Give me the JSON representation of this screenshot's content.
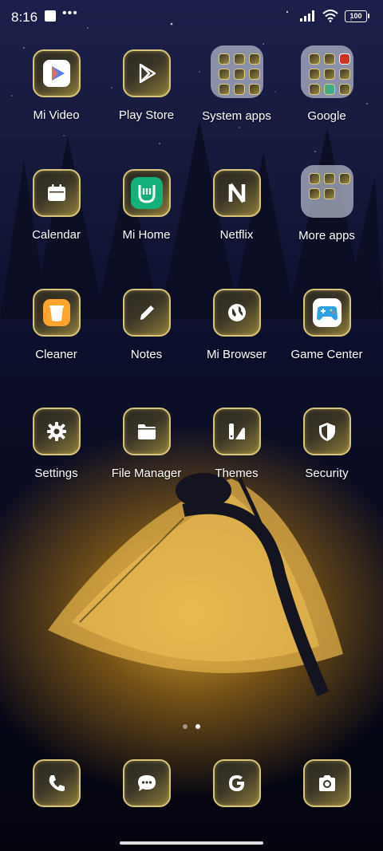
{
  "status_bar": {
    "time": "8:16",
    "battery": "100",
    "icons": [
      "notification-square-icon",
      "more-dots-icon",
      "signal-icon",
      "wifi-icon",
      "battery-icon"
    ]
  },
  "apps": [
    {
      "label": "Mi Video",
      "icon": "mi-video-icon"
    },
    {
      "label": "Play Store",
      "icon": "play-store-icon"
    },
    {
      "label": "System apps",
      "icon": "folder-icon"
    },
    {
      "label": "Google",
      "icon": "folder-icon"
    },
    {
      "label": "Calendar",
      "icon": "calendar-icon"
    },
    {
      "label": "Mi Home",
      "icon": "mi-home-icon"
    },
    {
      "label": "Netflix",
      "icon": "netflix-icon"
    },
    {
      "label": "More apps",
      "icon": "folder-icon"
    },
    {
      "label": "Cleaner",
      "icon": "cleaner-icon"
    },
    {
      "label": "Notes",
      "icon": "pencil-icon"
    },
    {
      "label": "Mi Browser",
      "icon": "globe-icon"
    },
    {
      "label": "Game Center",
      "icon": "gamepad-icon"
    },
    {
      "label": "Settings",
      "icon": "gear-icon"
    },
    {
      "label": "File Manager",
      "icon": "folder-file-icon"
    },
    {
      "label": "Themes",
      "icon": "themes-icon"
    },
    {
      "label": "Security",
      "icon": "shield-icon"
    }
  ],
  "dock": [
    {
      "icon": "phone-icon"
    },
    {
      "icon": "message-icon"
    },
    {
      "icon": "google-icon"
    },
    {
      "icon": "camera-icon"
    }
  ],
  "page_indicator": {
    "pages": 2,
    "current": 2
  }
}
